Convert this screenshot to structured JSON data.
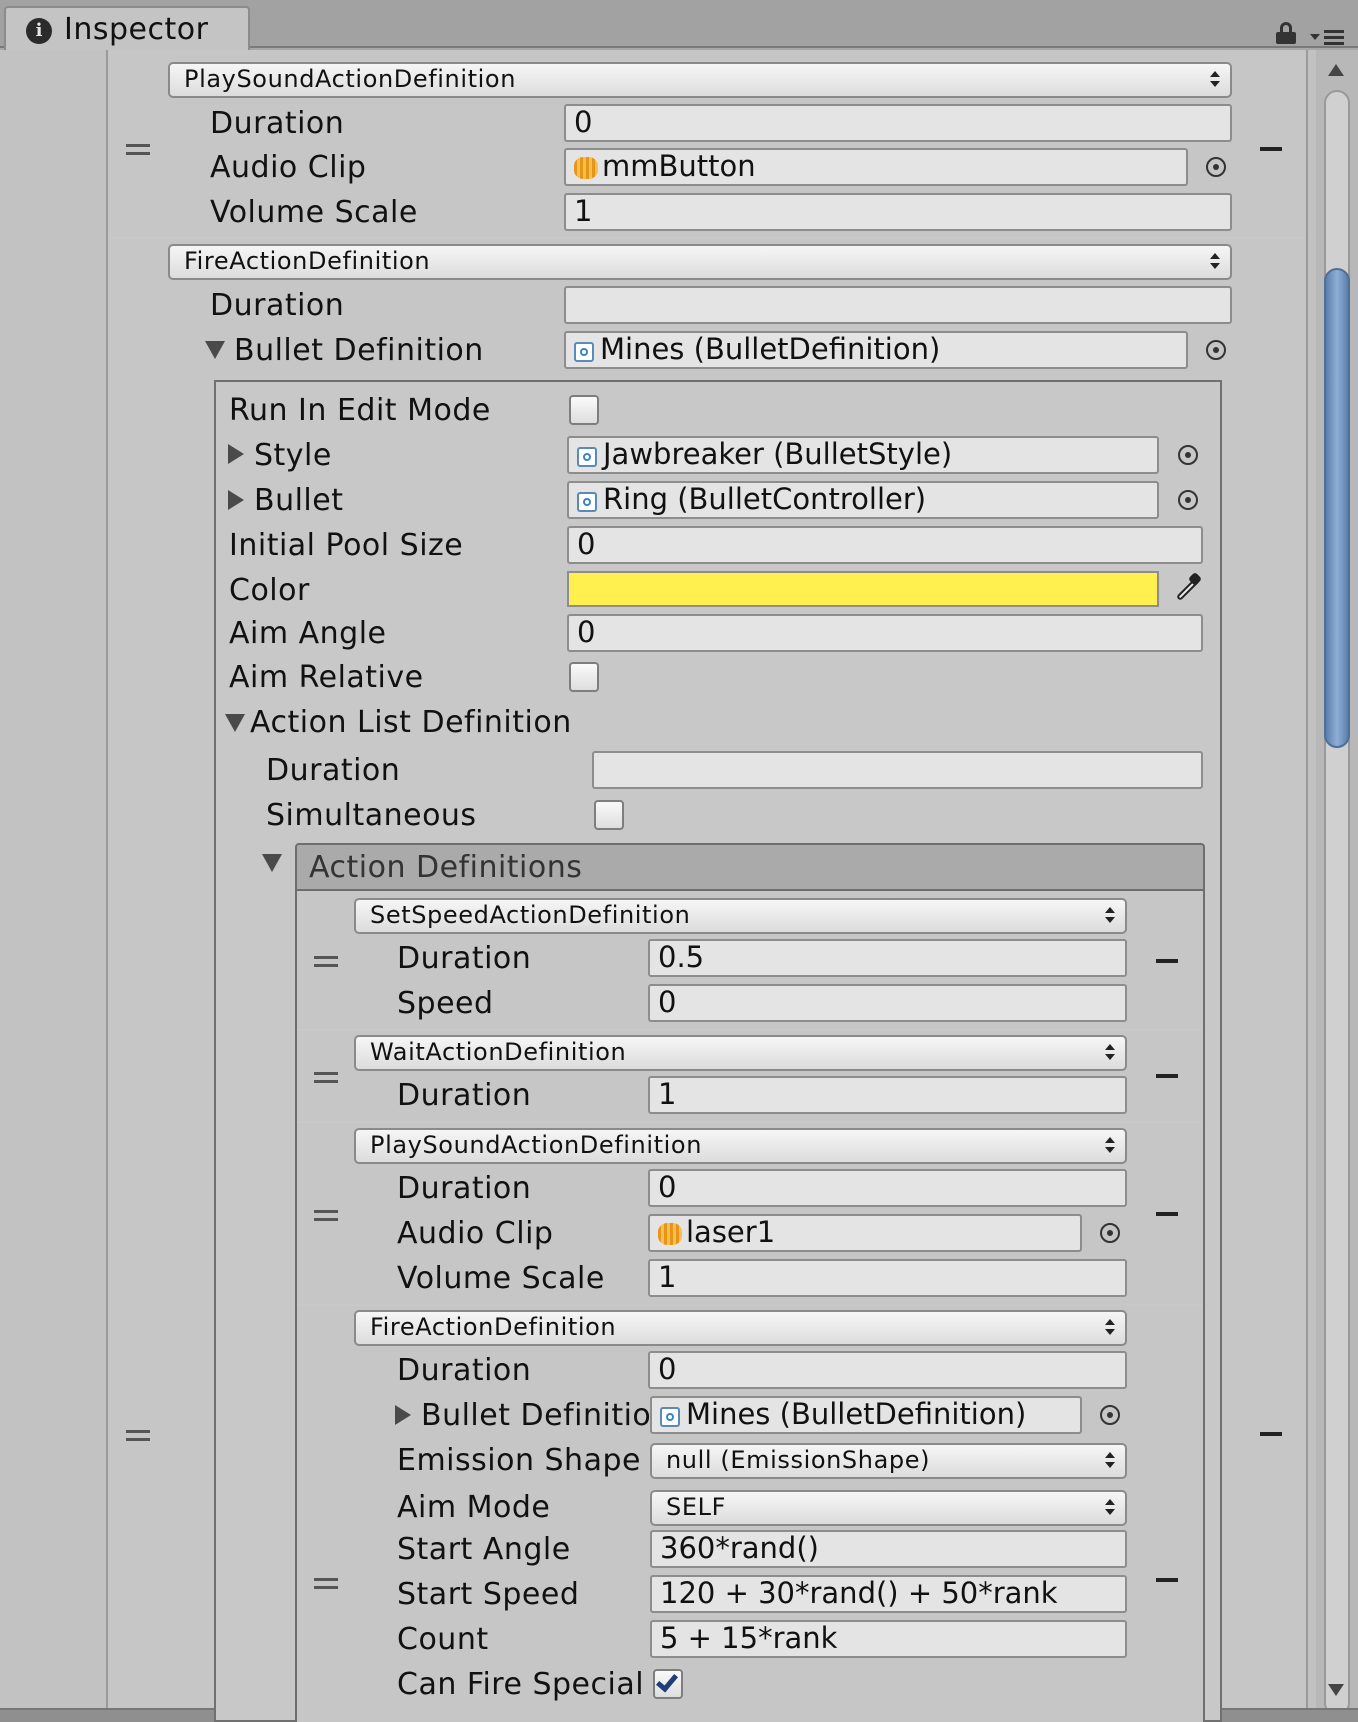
{
  "tab": {
    "title": "Inspector",
    "icon": "info-icon"
  },
  "header_icons": [
    "lock-icon",
    "menu-icon"
  ],
  "colors": {
    "field_bg": "#e4e4e4",
    "panel_bg": "#c2c2c2",
    "color_swatch": "#ffef4f",
    "scrollbar_thumb": "#6e8fb8"
  },
  "top_actions": {
    "play_sound": {
      "type": "PlaySoundActionDefinition",
      "duration_label": "Duration",
      "duration": "0",
      "audio_clip_label": "Audio Clip",
      "audio_clip": "mmButton",
      "volume_label": "Volume Scale",
      "volume": "1"
    },
    "fire": {
      "type": "FireActionDefinition",
      "duration_label": "Duration",
      "duration": "",
      "bullet_def_label": "Bullet Definition",
      "bullet_def": "Mines (BulletDefinition)"
    }
  },
  "bullet_def": {
    "run_edit_label": "Run In Edit Mode",
    "style_label": "Style",
    "style": "Jawbreaker (BulletStyle)",
    "bullet_label": "Bullet",
    "bullet": "Ring (BulletController)",
    "pool_label": "Initial Pool Size",
    "pool": "0",
    "color_label": "Color",
    "color": "#ffef4f",
    "aim_angle_label": "Aim Angle",
    "aim_angle": "0",
    "aim_rel_label": "Aim Relative",
    "action_list_label": "Action List Definition",
    "al_duration_label": "Duration",
    "al_duration": "",
    "simultaneous_label": "Simultaneous",
    "action_defs_label": "Action Definitions"
  },
  "inner": {
    "set_speed": {
      "type": "SetSpeedActionDefinition",
      "duration_label": "Duration",
      "duration": "0.5",
      "speed_label": "Speed",
      "speed": "0"
    },
    "wait": {
      "type": "WaitActionDefinition",
      "duration_label": "Duration",
      "duration": "1"
    },
    "play_sound": {
      "type": "PlaySoundActionDefinition",
      "duration_label": "Duration",
      "duration": "0",
      "audio_clip_label": "Audio Clip",
      "audio_clip": "laser1",
      "volume_label": "Volume Scale",
      "volume": "1"
    },
    "fire": {
      "type": "FireActionDefinition",
      "duration_label": "Duration",
      "duration": "0",
      "bullet_def_label": "Bullet Definition",
      "bullet_def": "Mines (BulletDefinition)",
      "emission_label": "Emission Shape",
      "emission": "null (EmissionShape)",
      "aim_mode_label": "Aim Mode",
      "aim_mode": "SELF",
      "start_angle_label": "Start Angle",
      "start_angle": "360*rand()",
      "start_speed_label": "Start Speed",
      "start_speed": "120 + 30*rand() + 50*rank",
      "count_label": "Count",
      "count": "5 + 15*rank",
      "can_fire_label": "Can Fire Special",
      "can_fire": true
    }
  }
}
